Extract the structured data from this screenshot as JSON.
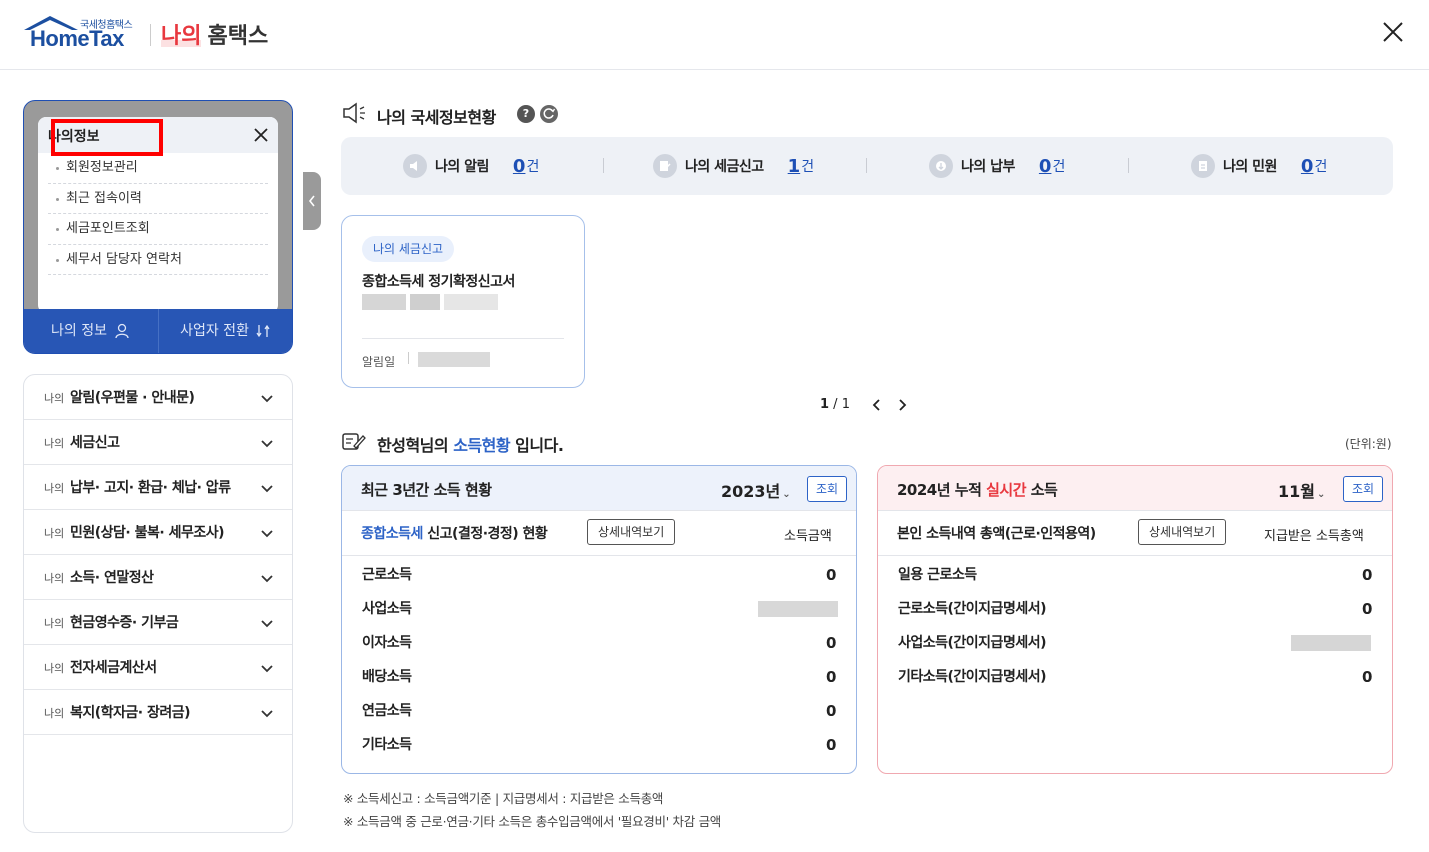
{
  "header": {
    "logo_small": "국세청홈택스",
    "logo_main": "HomeTax",
    "title_highlight": "나의",
    "title_rest": "홈택스"
  },
  "popup": {
    "title": "나의정보",
    "items": [
      "회원정보관리",
      "최근 접속이력",
      "세금포인트조회",
      "세무서 담당자 연락처"
    ]
  },
  "left_bar": {
    "my_info": "나의 정보",
    "switch_business": "사업자 전환"
  },
  "menu": [
    {
      "small": "나의",
      "label": "알림(우편물 · 안내문)"
    },
    {
      "small": "나의",
      "label": "세금신고"
    },
    {
      "small": "나의",
      "label": "납부· 고지· 환급· 체납· 압류"
    },
    {
      "small": "나의",
      "label": "민원(상담· 불복· 세무조사)"
    },
    {
      "small": "나의",
      "label": "소득· 연말정산"
    },
    {
      "small": "나의",
      "label": "현금영수증· 기부금"
    },
    {
      "small": "나의",
      "label": "전자세금계산서"
    },
    {
      "small": "나의",
      "label": "복지(학자금· 장려금)"
    }
  ],
  "status_section": {
    "title": "나의 국세정보현황",
    "help": "?",
    "items": [
      {
        "label": "나의 알림",
        "count": "0",
        "unit": "건"
      },
      {
        "label": "나의 세금신고",
        "count": "1",
        "unit": "건"
      },
      {
        "label": "나의 납부",
        "count": "0",
        "unit": "건"
      },
      {
        "label": "나의 민원",
        "count": "0",
        "unit": "건"
      }
    ]
  },
  "card": {
    "badge": "나의 세금신고",
    "title": "종합소득세 정기확정신고서",
    "date_label": "알림일"
  },
  "pager": {
    "current": "1",
    "separator": " / ",
    "total": "1"
  },
  "income_section": {
    "name": "한성혁님의",
    "highlight": "소득현황",
    "suffix": "입니다.",
    "unit_note": "(단위:원)"
  },
  "panel_left": {
    "title": "최근 3년간 소득 현황",
    "year": "2023년",
    "button": "조회",
    "sub_highlight": "종합소득세",
    "sub_rest": "신고(결정·경정) 현황",
    "detail_button": "상세내역보기",
    "column": "소득금액",
    "rows": [
      {
        "label": "근로소득",
        "value": "0"
      },
      {
        "label": "사업소득",
        "value": ""
      },
      {
        "label": "이자소득",
        "value": "0"
      },
      {
        "label": "배당소득",
        "value": "0"
      },
      {
        "label": "연금소득",
        "value": "0"
      },
      {
        "label": "기타소득",
        "value": "0"
      }
    ]
  },
  "panel_right": {
    "title_prefix": "2024년 누적",
    "title_highlight": "실시간",
    "title_suffix": "소득",
    "month": "11월",
    "button": "조회",
    "sub_title": "본인 소득내역 총액(근로·인적용역)",
    "detail_button": "상세내역보기",
    "column": "지급받은 소득총액",
    "rows": [
      {
        "label": "일용 근로소득",
        "value": "0"
      },
      {
        "label": "근로소득(간이지급명세서)",
        "value": "0"
      },
      {
        "label": "사업소득(간이지급명세서)",
        "value": ""
      },
      {
        "label": "기타소득(간이지급명세서)",
        "value": "0"
      }
    ]
  },
  "notes": [
    "※ 소득세신고 : 소득금액기준  |  지급명세서 : 지급받은 소득총액",
    "※ 소득금액 중 근로·연금·기타 소득은 총수입금액에서 '필요경비' 차감 금액"
  ],
  "colors": {
    "brand_blue": "#1c4fa0",
    "accent_blue": "#2d63c7",
    "red": "#e8383f",
    "highlight_box": "#ff0000"
  }
}
